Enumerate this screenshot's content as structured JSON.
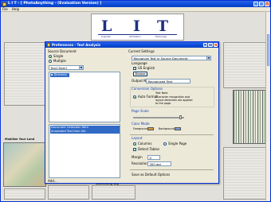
{
  "app": {
    "title": "L I T - [ PhotoAnything - (Evaluation Version) ]",
    "menu": [
      "File",
      "Help"
    ],
    "logo": {
      "letters": [
        "L",
        "I",
        "T"
      ],
      "captions": [
        "Linguistic",
        "Information",
        "Technology"
      ]
    },
    "headings": [
      "Mobilize Your Land",
      "Something Big"
    ]
  },
  "dialog": {
    "title": "Preferences - Text Analysis",
    "left": {
      "section_label": "Source Document",
      "radio_1": "Single",
      "radio_2": "Multiple",
      "folder_field": "Text [Item]",
      "tree_root": "Directory",
      "list_items": [
        "Document Collection Item",
        "Annotated Text Item Set"
      ],
      "footer": "Add..."
    },
    "right": {
      "settings_label": "Current Settings",
      "mode_select": "Recognize Text in Source Document",
      "language_label": "Language",
      "language_value": "US English",
      "browse_button": "Browse",
      "output_label": "Output Name",
      "output_value": "Recognized Text",
      "options_label": "Conversion Options",
      "option_1": "Auto Format",
      "note_title": "Text Note",
      "note_line_1": "Character recognition and",
      "note_line_2": "layout detection are applied",
      "note_line_3": "to the page.",
      "scale_label": "Page Scale",
      "color_label": "Color Mode",
      "color_sub_1": "Foreground",
      "color_sub_2": "Background",
      "layout_label": "Layout",
      "layout_opt_1": "Columns",
      "layout_opt_2": "Single Page",
      "check_label": "Detect Tables",
      "margin_label": "Margin",
      "margin_value": "0",
      "resolution_label": "Resolution",
      "resolution_value": "300 dpi",
      "bottom_label": "Save as Default Options"
    }
  }
}
